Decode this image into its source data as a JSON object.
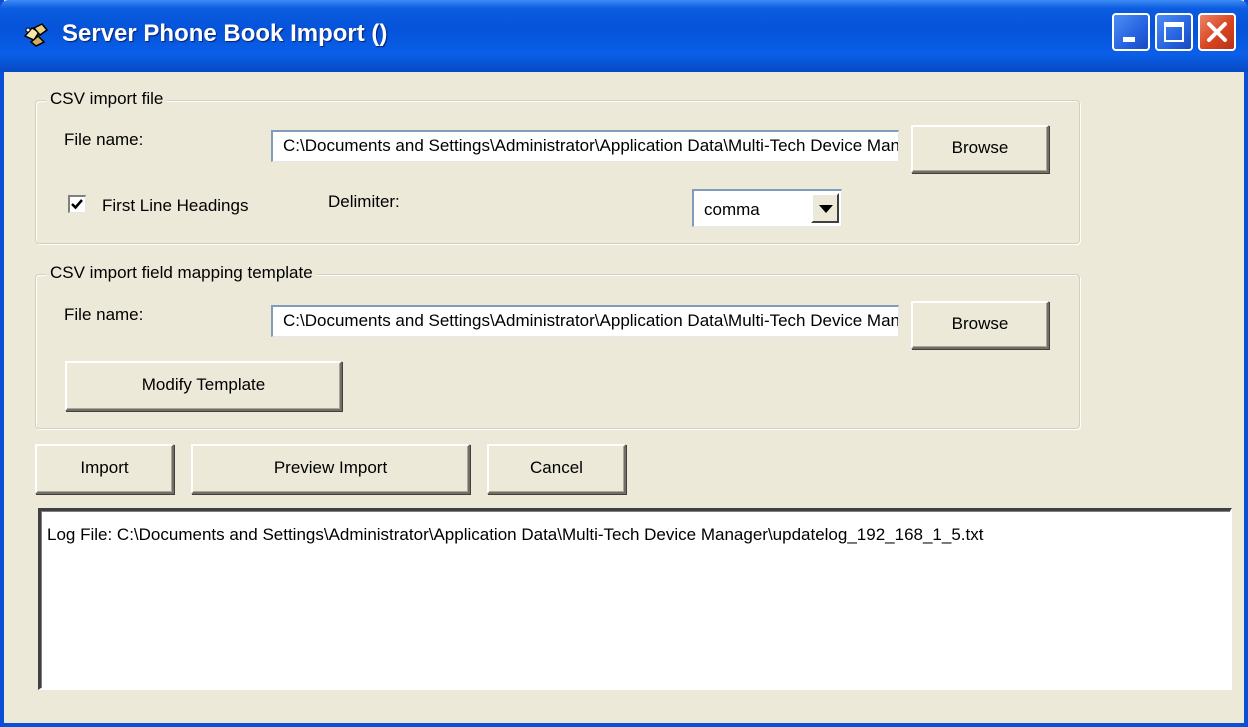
{
  "window": {
    "title": "Server Phone Book Import ()",
    "icons": {
      "app": "phone-book-app-icon",
      "minimize": "minimize-icon",
      "maximize": "maximize-icon",
      "close": "close-icon"
    }
  },
  "csv_import": {
    "legend": "CSV import file",
    "file_label": "File name:",
    "file_value": "C:\\Documents and Settings\\Administrator\\Application Data\\Multi-Tech Device Manager\\",
    "browse_label": "Browse",
    "first_line_label": "First Line Headings",
    "first_line_checked": true,
    "delimiter_label": "Delimiter:",
    "delimiter_value": "comma"
  },
  "mapping": {
    "legend": "CSV import field mapping template",
    "file_label": "File name:",
    "file_value": "C:\\Documents and Settings\\Administrator\\Application Data\\Multi-Tech Device Manager\\",
    "browse_label": "Browse",
    "modify_label": "Modify Template"
  },
  "actions": {
    "import_label": "Import",
    "preview_label": "Preview Import",
    "cancel_label": "Cancel"
  },
  "log": {
    "text": "Log File: C:\\Documents and Settings\\Administrator\\Application Data\\Multi-Tech Device Manager\\updatelog_192_168_1_5.txt"
  }
}
